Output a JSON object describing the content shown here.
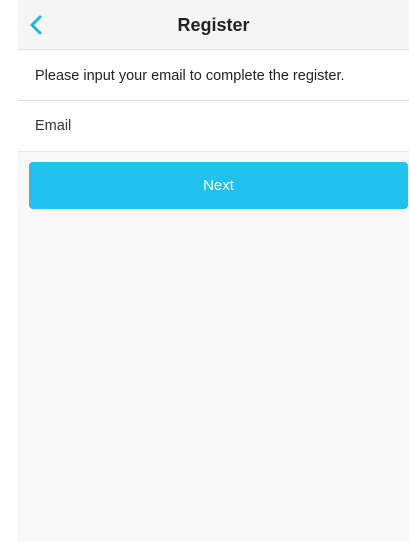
{
  "header": {
    "title": "Register",
    "back_icon": "chevron-left-icon"
  },
  "form": {
    "message": "Please input your email to complete the register.",
    "email_value": "",
    "email_placeholder": "Email",
    "next_label": "Next"
  },
  "colors": {
    "accent": "#1fc1ee",
    "back_icon": "#1fb4e6",
    "header_bg": "#f5f5f5",
    "page_bg": "#f8f8f8"
  }
}
